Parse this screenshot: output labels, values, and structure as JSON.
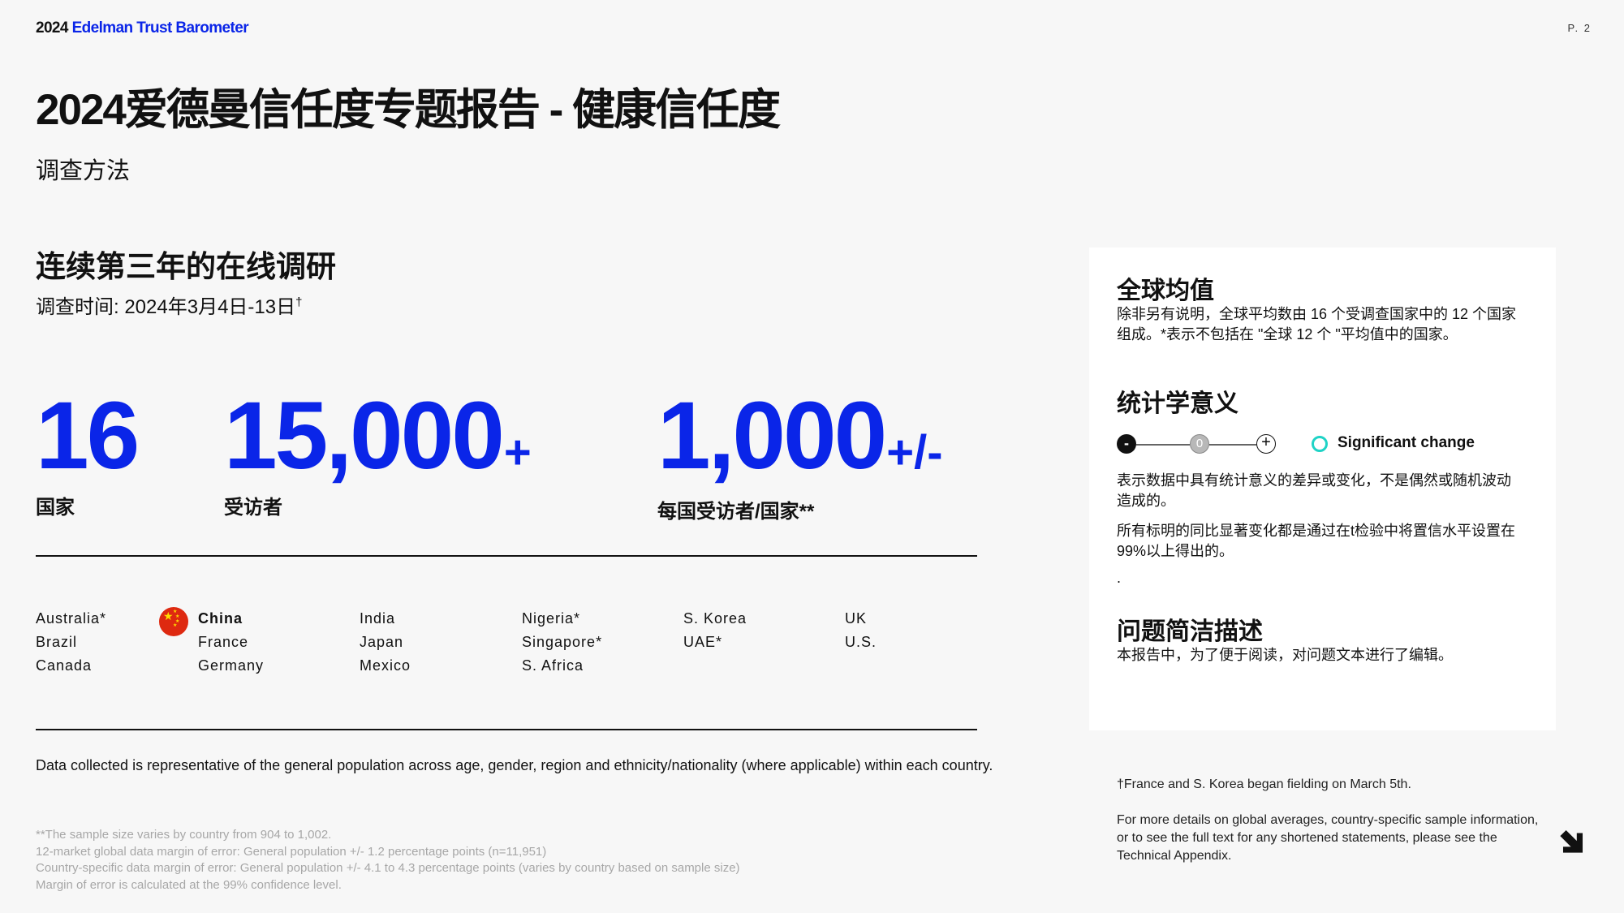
{
  "header": {
    "brand_year": "2024",
    "brand_name": "Edelman Trust Barometer",
    "page_number": "P. 2"
  },
  "title": "2024爱德曼信任度专题报告 - 健康信任度",
  "subtitle": "调查方法",
  "survey": {
    "heading": "连续第三年的在线调研",
    "date": "调查时间: 2024年3月4日-13日",
    "date_mark": "†"
  },
  "stats": [
    {
      "number": "16",
      "suffix": "",
      "label": "国家"
    },
    {
      "number": "15,000",
      "suffix": "+",
      "label": "受访者"
    },
    {
      "number": "1,000",
      "suffix": "+/-",
      "label": "每国受访者/国家**"
    }
  ],
  "countries": {
    "col1": [
      "Australia*",
      "Brazil",
      "Canada"
    ],
    "col2": [
      "China",
      "France",
      "Germany"
    ],
    "col3": [
      "India",
      "Japan",
      "Mexico"
    ],
    "col4": [
      "Nigeria*",
      "Singapore*",
      "S. Africa"
    ],
    "col5": [
      "S. Korea",
      "UAE*"
    ],
    "col6": [
      "UK",
      "U.S."
    ],
    "highlighted": "China"
  },
  "collected_note": "Data collected is representative of the general population across age, gender, region and ethnicity/nationality (where applicable) within each country.",
  "fine_print": [
    "**The sample size varies by country from 904 to 1,002.",
    "12-market global data margin of error: General population +/- 1.2 percentage points (n=11,951)",
    "Country-specific data margin of error: General population +/- 4.1 to 4.3 percentage points (varies by country based on sample size)",
    "Margin of error is calculated at the 99% confidence level."
  ],
  "panel": {
    "global_avg_title": "全球均值",
    "global_avg_text": "除非另有说明，全球平均数由 16 个受调查国家中的 12 个国家组成。*表示不包括在 \"全球 12 个 \"平均值中的国家。",
    "stat_sig_title": "统计学意义",
    "scale_minus": "-",
    "scale_zero": "0",
    "scale_plus": "+",
    "sig_label": "Significant change",
    "stat_sig_text1": "表示数据中具有统计意义的差异或变化，不是偶然或随机波动造成的。",
    "stat_sig_text2": "所有标明的同比显著变化都是通过在t检验中将置信水平设置在99%以上得出的。",
    "stat_sig_text3": ".",
    "brief_title": "问题简洁描述",
    "brief_text": "本报告中，为了便于阅读，对问题文本进行了编辑。"
  },
  "notes": {
    "fielding": "†France and S. Korea began fielding on March 5th.",
    "details": "For more details on global averages, country-specific sample information, or to see the full text for any shortened statements, please see the Technical Appendix."
  },
  "colors": {
    "accent_blue": "#0a25e8",
    "significant_ring": "#1fd3c6",
    "background": "#f7f7f7"
  },
  "icons": [
    "china-flag-icon",
    "next-arrow-icon"
  ]
}
